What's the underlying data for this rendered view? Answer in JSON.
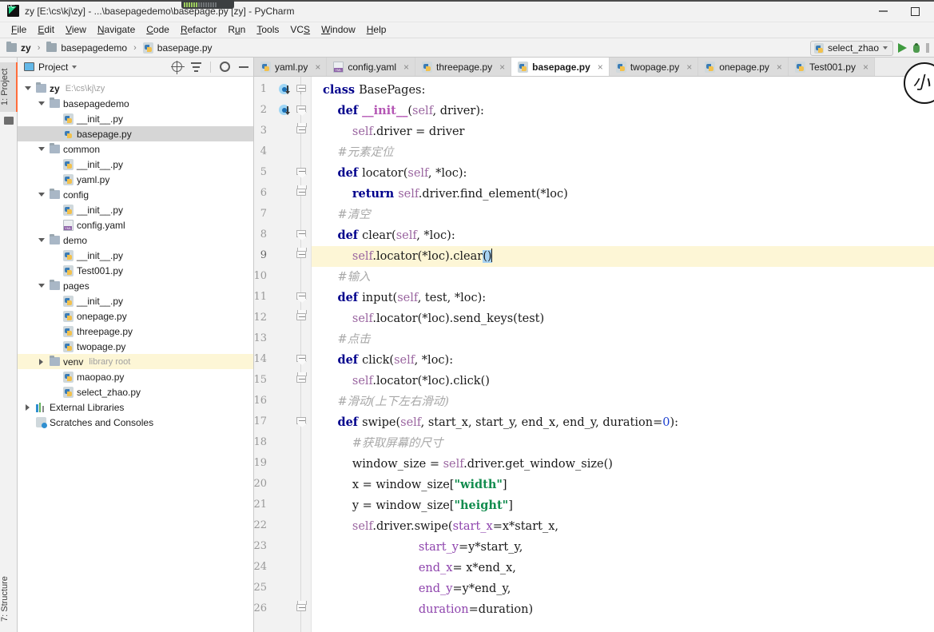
{
  "window": {
    "title": "zy [E:\\cs\\kj\\zy] - ...\\basepagedemo\\basepage.py [zy] - PyCharm",
    "app_icon": "pycharm-logo-icon",
    "minimize_label": "–",
    "maximize_label": "□"
  },
  "menu": [
    {
      "label": "File",
      "mnemonic": "F"
    },
    {
      "label": "Edit",
      "mnemonic": "E"
    },
    {
      "label": "View",
      "mnemonic": "V"
    },
    {
      "label": "Navigate",
      "mnemonic": "N"
    },
    {
      "label": "Code",
      "mnemonic": "C"
    },
    {
      "label": "Refactor",
      "mnemonic": "R"
    },
    {
      "label": "Run",
      "mnemonic": "u"
    },
    {
      "label": "Tools",
      "mnemonic": "T"
    },
    {
      "label": "VCS",
      "mnemonic": "S"
    },
    {
      "label": "Window",
      "mnemonic": "W"
    },
    {
      "label": "Help",
      "mnemonic": "H"
    }
  ],
  "navbar": {
    "breadcrumb": [
      {
        "label": "zy",
        "icon": "folder-icon",
        "bold": true
      },
      {
        "label": "basepagedemo",
        "icon": "folder-icon",
        "bold": false
      },
      {
        "label": "basepage.py",
        "icon": "python-file-icon",
        "bold": false
      }
    ],
    "separator": "›",
    "run_configuration": "select_zhao",
    "run_button": "run-icon",
    "debug_button": "debug-icon",
    "stop_button": "stop-icon"
  },
  "left_tool_window_bar": {
    "top": "1: Project",
    "bottom": "7: Structure"
  },
  "project_panel": {
    "title": "Project",
    "tools": [
      "locate-icon",
      "collapse-all-icon",
      "settings-gear-icon",
      "hide-icon"
    ],
    "tree": [
      {
        "label": "zy",
        "path": "E:\\cs\\kj\\zy",
        "icon": "folder-icon",
        "indent": 0,
        "twisty": "expanded",
        "bold": true,
        "state": ""
      },
      {
        "label": "basepagedemo",
        "path": "",
        "icon": "folder-icon",
        "indent": 1,
        "twisty": "expanded",
        "bold": false,
        "state": ""
      },
      {
        "label": "__init__.py",
        "path": "",
        "icon": "python-file-icon",
        "indent": 2,
        "twisty": "none",
        "bold": false,
        "state": ""
      },
      {
        "label": "basepage.py",
        "path": "",
        "icon": "python-file-icon",
        "indent": 2,
        "twisty": "none",
        "bold": false,
        "state": "selected"
      },
      {
        "label": "common",
        "path": "",
        "icon": "folder-icon",
        "indent": 1,
        "twisty": "expanded",
        "bold": false,
        "state": ""
      },
      {
        "label": "__init__.py",
        "path": "",
        "icon": "python-file-icon",
        "indent": 2,
        "twisty": "none",
        "bold": false,
        "state": ""
      },
      {
        "label": "yaml.py",
        "path": "",
        "icon": "python-file-icon",
        "indent": 2,
        "twisty": "none",
        "bold": false,
        "state": ""
      },
      {
        "label": "config",
        "path": "",
        "icon": "folder-icon",
        "indent": 1,
        "twisty": "expanded",
        "bold": false,
        "state": ""
      },
      {
        "label": "__init__.py",
        "path": "",
        "icon": "python-file-icon",
        "indent": 2,
        "twisty": "none",
        "bold": false,
        "state": ""
      },
      {
        "label": "config.yaml",
        "path": "",
        "icon": "yaml-file-icon",
        "indent": 2,
        "twisty": "none",
        "bold": false,
        "state": ""
      },
      {
        "label": "demo",
        "path": "",
        "icon": "folder-icon",
        "indent": 1,
        "twisty": "expanded",
        "bold": false,
        "state": ""
      },
      {
        "label": "__init__.py",
        "path": "",
        "icon": "python-file-icon",
        "indent": 2,
        "twisty": "none",
        "bold": false,
        "state": ""
      },
      {
        "label": "Test001.py",
        "path": "",
        "icon": "python-file-icon",
        "indent": 2,
        "twisty": "none",
        "bold": false,
        "state": ""
      },
      {
        "label": "pages",
        "path": "",
        "icon": "folder-icon",
        "indent": 1,
        "twisty": "expanded",
        "bold": false,
        "state": ""
      },
      {
        "label": "__init__.py",
        "path": "",
        "icon": "python-file-icon",
        "indent": 2,
        "twisty": "none",
        "bold": false,
        "state": ""
      },
      {
        "label": "onepage.py",
        "path": "",
        "icon": "python-file-icon",
        "indent": 2,
        "twisty": "none",
        "bold": false,
        "state": ""
      },
      {
        "label": "threepage.py",
        "path": "",
        "icon": "python-file-icon",
        "indent": 2,
        "twisty": "none",
        "bold": false,
        "state": ""
      },
      {
        "label": "twopage.py",
        "path": "",
        "icon": "python-file-icon",
        "indent": 2,
        "twisty": "none",
        "bold": false,
        "state": ""
      },
      {
        "label": "venv",
        "path": "library root",
        "icon": "folder-icon",
        "indent": 1,
        "twisty": "collapsed",
        "bold": false,
        "state": "highlighted"
      },
      {
        "label": "maopao.py",
        "path": "",
        "icon": "python-file-icon",
        "indent": 2,
        "twisty": "none",
        "bold": false,
        "state": ""
      },
      {
        "label": "select_zhao.py",
        "path": "",
        "icon": "python-file-icon",
        "indent": 2,
        "twisty": "none",
        "bold": false,
        "state": ""
      },
      {
        "label": "External Libraries",
        "path": "",
        "icon": "library-icon",
        "indent": 0,
        "twisty": "collapsed",
        "bold": false,
        "state": ""
      },
      {
        "label": "Scratches and Consoles",
        "path": "",
        "icon": "scratches-icon",
        "indent": 0,
        "twisty": "none",
        "bold": false,
        "state": ""
      }
    ]
  },
  "editor": {
    "tabs": [
      {
        "label": "yaml.py",
        "icon": "python-file-icon",
        "active": false
      },
      {
        "label": "config.yaml",
        "icon": "yaml-file-icon",
        "active": false
      },
      {
        "label": "threepage.py",
        "icon": "python-file-icon",
        "active": false
      },
      {
        "label": "basepage.py",
        "icon": "python-file-icon",
        "active": true
      },
      {
        "label": "twopage.py",
        "icon": "python-file-icon",
        "active": false
      },
      {
        "label": "onepage.py",
        "icon": "python-file-icon",
        "active": false
      },
      {
        "label": "Test001.py",
        "icon": "python-file-icon",
        "active": false
      }
    ],
    "close_glyph": "×",
    "caret_line": 9,
    "selection": "()",
    "lines": [
      {
        "n": 1,
        "marker": "implemented-icon",
        "fold": "open",
        "highlight": false,
        "tokens": [
          {
            "t": "class ",
            "c": "kw"
          },
          {
            "t": "BasePages",
            "c": "fn"
          },
          {
            "t": ":",
            "c": "fn"
          }
        ]
      },
      {
        "n": 2,
        "marker": "implemented-icon",
        "fold": "tip",
        "highlight": false,
        "tokens": [
          {
            "t": "    ",
            "c": "fn"
          },
          {
            "t": "def ",
            "c": "kw"
          },
          {
            "t": "__init__",
            "c": "dund"
          },
          {
            "t": "(",
            "c": "fn"
          },
          {
            "t": "self",
            "c": "slf"
          },
          {
            "t": ", driver):",
            "c": "fn"
          }
        ]
      },
      {
        "n": 3,
        "marker": "",
        "fold": "end",
        "highlight": false,
        "tokens": [
          {
            "t": "        ",
            "c": "fn"
          },
          {
            "t": "self",
            "c": "slf"
          },
          {
            "t": ".driver = driver",
            "c": "fn"
          }
        ]
      },
      {
        "n": 4,
        "marker": "",
        "fold": "",
        "highlight": false,
        "tokens": [
          {
            "t": "    ",
            "c": "fn"
          },
          {
            "t": "#元素定位",
            "c": "cmt"
          }
        ]
      },
      {
        "n": 5,
        "marker": "",
        "fold": "tip",
        "highlight": false,
        "tokens": [
          {
            "t": "    ",
            "c": "fn"
          },
          {
            "t": "def ",
            "c": "kw"
          },
          {
            "t": "locator",
            "c": "fn"
          },
          {
            "t": "(",
            "c": "fn"
          },
          {
            "t": "self",
            "c": "slf"
          },
          {
            "t": ", *loc):",
            "c": "fn"
          }
        ]
      },
      {
        "n": 6,
        "marker": "",
        "fold": "end",
        "highlight": false,
        "tokens": [
          {
            "t": "        ",
            "c": "fn"
          },
          {
            "t": "return ",
            "c": "kw"
          },
          {
            "t": "self",
            "c": "slf"
          },
          {
            "t": ".driver.find_element(*loc)",
            "c": "fn"
          }
        ]
      },
      {
        "n": 7,
        "marker": "",
        "fold": "",
        "highlight": false,
        "tokens": [
          {
            "t": "    ",
            "c": "fn"
          },
          {
            "t": "#清空",
            "c": "cmt"
          }
        ]
      },
      {
        "n": 8,
        "marker": "",
        "fold": "tip",
        "highlight": false,
        "tokens": [
          {
            "t": "    ",
            "c": "fn"
          },
          {
            "t": "def ",
            "c": "kw"
          },
          {
            "t": "clear",
            "c": "fn"
          },
          {
            "t": "(",
            "c": "fn"
          },
          {
            "t": "self",
            "c": "slf"
          },
          {
            "t": ", *loc):",
            "c": "fn"
          }
        ]
      },
      {
        "n": 9,
        "marker": "",
        "fold": "end",
        "highlight": true,
        "tokens": [
          {
            "t": "        ",
            "c": "fn"
          },
          {
            "t": "self",
            "c": "slf"
          },
          {
            "t": ".locator(*loc).clear",
            "c": "fn"
          },
          {
            "t": "()",
            "c": "sel-paren"
          },
          {
            "t": "",
            "c": "caret"
          }
        ]
      },
      {
        "n": 10,
        "marker": "",
        "fold": "",
        "highlight": false,
        "tokens": [
          {
            "t": "    ",
            "c": "fn"
          },
          {
            "t": "#输入",
            "c": "cmt"
          }
        ]
      },
      {
        "n": 11,
        "marker": "",
        "fold": "tip",
        "highlight": false,
        "tokens": [
          {
            "t": "    ",
            "c": "fn"
          },
          {
            "t": "def ",
            "c": "kw"
          },
          {
            "t": "input",
            "c": "fn"
          },
          {
            "t": "(",
            "c": "fn"
          },
          {
            "t": "self",
            "c": "slf"
          },
          {
            "t": ", test, *loc):",
            "c": "fn"
          }
        ]
      },
      {
        "n": 12,
        "marker": "",
        "fold": "end",
        "highlight": false,
        "tokens": [
          {
            "t": "        ",
            "c": "fn"
          },
          {
            "t": "self",
            "c": "slf"
          },
          {
            "t": ".locator(*loc).send_keys(test)",
            "c": "fn"
          }
        ]
      },
      {
        "n": 13,
        "marker": "",
        "fold": "",
        "highlight": false,
        "tokens": [
          {
            "t": "    ",
            "c": "fn"
          },
          {
            "t": "#点击",
            "c": "cmt"
          }
        ]
      },
      {
        "n": 14,
        "marker": "",
        "fold": "tip",
        "highlight": false,
        "tokens": [
          {
            "t": "    ",
            "c": "fn"
          },
          {
            "t": "def ",
            "c": "kw"
          },
          {
            "t": "click",
            "c": "fn"
          },
          {
            "t": "(",
            "c": "fn"
          },
          {
            "t": "self",
            "c": "slf"
          },
          {
            "t": ", *loc):",
            "c": "fn"
          }
        ]
      },
      {
        "n": 15,
        "marker": "",
        "fold": "end",
        "highlight": false,
        "tokens": [
          {
            "t": "        ",
            "c": "fn"
          },
          {
            "t": "self",
            "c": "slf"
          },
          {
            "t": ".locator(*loc).click()",
            "c": "fn"
          }
        ]
      },
      {
        "n": 16,
        "marker": "",
        "fold": "",
        "highlight": false,
        "tokens": [
          {
            "t": "    ",
            "c": "fn"
          },
          {
            "t": "#滑动(上下左右滑动)",
            "c": "cmt"
          }
        ]
      },
      {
        "n": 17,
        "marker": "",
        "fold": "tip",
        "highlight": false,
        "tokens": [
          {
            "t": "    ",
            "c": "fn"
          },
          {
            "t": "def ",
            "c": "kw"
          },
          {
            "t": "swipe",
            "c": "fn"
          },
          {
            "t": "(",
            "c": "fn"
          },
          {
            "t": "self",
            "c": "slf"
          },
          {
            "t": ", start_x, start_y, end_x, end_y, duration=",
            "c": "fn"
          },
          {
            "t": "0",
            "c": "num"
          },
          {
            "t": "):",
            "c": "fn"
          }
        ]
      },
      {
        "n": 18,
        "marker": "",
        "fold": "",
        "highlight": false,
        "tokens": [
          {
            "t": "        ",
            "c": "fn"
          },
          {
            "t": "#获取屏幕的尺寸",
            "c": "cmt"
          }
        ]
      },
      {
        "n": 19,
        "marker": "",
        "fold": "",
        "highlight": false,
        "tokens": [
          {
            "t": "        window_size = ",
            "c": "fn"
          },
          {
            "t": "self",
            "c": "slf"
          },
          {
            "t": ".driver.get_window_size()",
            "c": "fn"
          }
        ]
      },
      {
        "n": 20,
        "marker": "",
        "fold": "",
        "highlight": false,
        "tokens": [
          {
            "t": "        x = window_size[",
            "c": "fn"
          },
          {
            "t": "\"width\"",
            "c": "str"
          },
          {
            "t": "]",
            "c": "fn"
          }
        ]
      },
      {
        "n": 21,
        "marker": "",
        "fold": "",
        "highlight": false,
        "tokens": [
          {
            "t": "        y = window_size[",
            "c": "fn"
          },
          {
            "t": "\"height\"",
            "c": "str"
          },
          {
            "t": "]",
            "c": "fn"
          }
        ]
      },
      {
        "n": 22,
        "marker": "",
        "fold": "",
        "highlight": false,
        "tokens": [
          {
            "t": "        ",
            "c": "fn"
          },
          {
            "t": "self",
            "c": "slf"
          },
          {
            "t": ".driver.swipe(",
            "c": "fn"
          },
          {
            "t": "start_x",
            "c": "kwarg"
          },
          {
            "t": "=x*start_x,",
            "c": "fn"
          }
        ]
      },
      {
        "n": 23,
        "marker": "",
        "fold": "",
        "highlight": false,
        "tokens": [
          {
            "t": "                          ",
            "c": "fn"
          },
          {
            "t": "start_y",
            "c": "kwarg"
          },
          {
            "t": "=y*start_y,",
            "c": "fn"
          }
        ]
      },
      {
        "n": 24,
        "marker": "",
        "fold": "",
        "highlight": false,
        "tokens": [
          {
            "t": "                          ",
            "c": "fn"
          },
          {
            "t": "end_x",
            "c": "kwarg"
          },
          {
            "t": "= x*end_x,",
            "c": "fn"
          }
        ]
      },
      {
        "n": 25,
        "marker": "",
        "fold": "",
        "highlight": false,
        "tokens": [
          {
            "t": "                          ",
            "c": "fn"
          },
          {
            "t": "end_y",
            "c": "kwarg"
          },
          {
            "t": "=y*end_y,",
            "c": "fn"
          }
        ]
      },
      {
        "n": 26,
        "marker": "",
        "fold": "end",
        "highlight": false,
        "tokens": [
          {
            "t": "                          ",
            "c": "fn"
          },
          {
            "t": "duration",
            "c": "kwarg"
          },
          {
            "t": "=duration)",
            "c": "fn"
          }
        ]
      }
    ]
  },
  "overlay": {
    "magnifier_glyph": "小"
  },
  "colors": {
    "accent_orange": "#ff6d3b",
    "keyword_blue": "#00008c",
    "string_green": "#118c4e",
    "self_purple": "#9a65a0",
    "kwarg_purple": "#8e44ad",
    "comment_grey": "#a8a8a8",
    "caret_line_yellow": "#fdf6d6",
    "selection_blue": "#a6d2f2",
    "tree_selected_grey": "#d6d6d6"
  }
}
